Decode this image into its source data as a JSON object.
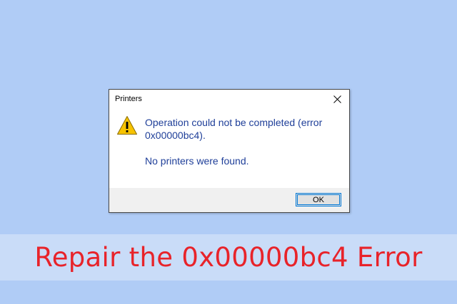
{
  "dialog": {
    "title": "Printers",
    "icon": "warning-triangle-icon",
    "message_primary": "Operation could not be completed (error 0x00000bc4).",
    "message_secondary": "No printers were found.",
    "ok_label": "OK"
  },
  "banner": {
    "text": "Repair the 0x00000bc4 Error"
  },
  "colors": {
    "background": "#b0ccf6",
    "banner_background": "#c9dcf8",
    "banner_text": "#e8232a",
    "message_text": "#1f3f99",
    "warning_fill": "#f7c300",
    "focus_border": "#0078d7"
  }
}
